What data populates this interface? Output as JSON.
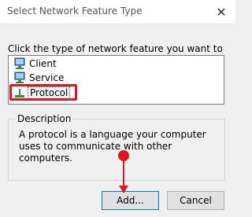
{
  "window": {
    "title": "Select Network Feature Type",
    "close_icon": "close-icon"
  },
  "instruction": "Click the type of network feature you want to install:",
  "features": [
    {
      "label": "Client",
      "icon": "client-icon"
    },
    {
      "label": "Service",
      "icon": "service-icon"
    },
    {
      "label": "Protocol",
      "icon": "protocol-icon",
      "selected": true
    }
  ],
  "description": {
    "title": "Description",
    "text": "A protocol is a language your computer uses to communicate with other computers."
  },
  "buttons": {
    "add": "Add...",
    "cancel": "Cancel"
  },
  "colors": {
    "annotation": "#e0161e",
    "focus_border": "#0078d7"
  }
}
